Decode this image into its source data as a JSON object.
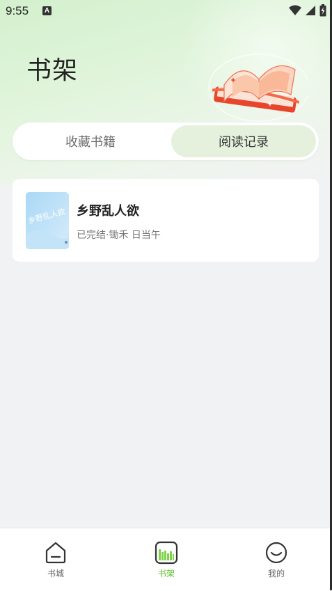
{
  "status_bar": {
    "time": "9:55",
    "notification_badge": "A"
  },
  "header": {
    "title": "书架"
  },
  "tabs": [
    {
      "label": "收藏书籍",
      "active": false
    },
    {
      "label": "阅读记录",
      "active": true
    }
  ],
  "books": [
    {
      "title": "乡野乱人欲",
      "meta": "已完结·锄禾 日当午",
      "cover_text": "乡野乱人欲"
    }
  ],
  "bottom_nav": [
    {
      "label": "书城",
      "icon": "home-icon",
      "active": false
    },
    {
      "label": "书架",
      "icon": "bookshelf-icon",
      "active": true
    },
    {
      "label": "我的",
      "icon": "profile-icon",
      "active": false
    }
  ],
  "colors": {
    "accent": "#5bbf2a",
    "active_tab_bg": "#e5f1dd",
    "header_green": "#d3f0cd"
  }
}
